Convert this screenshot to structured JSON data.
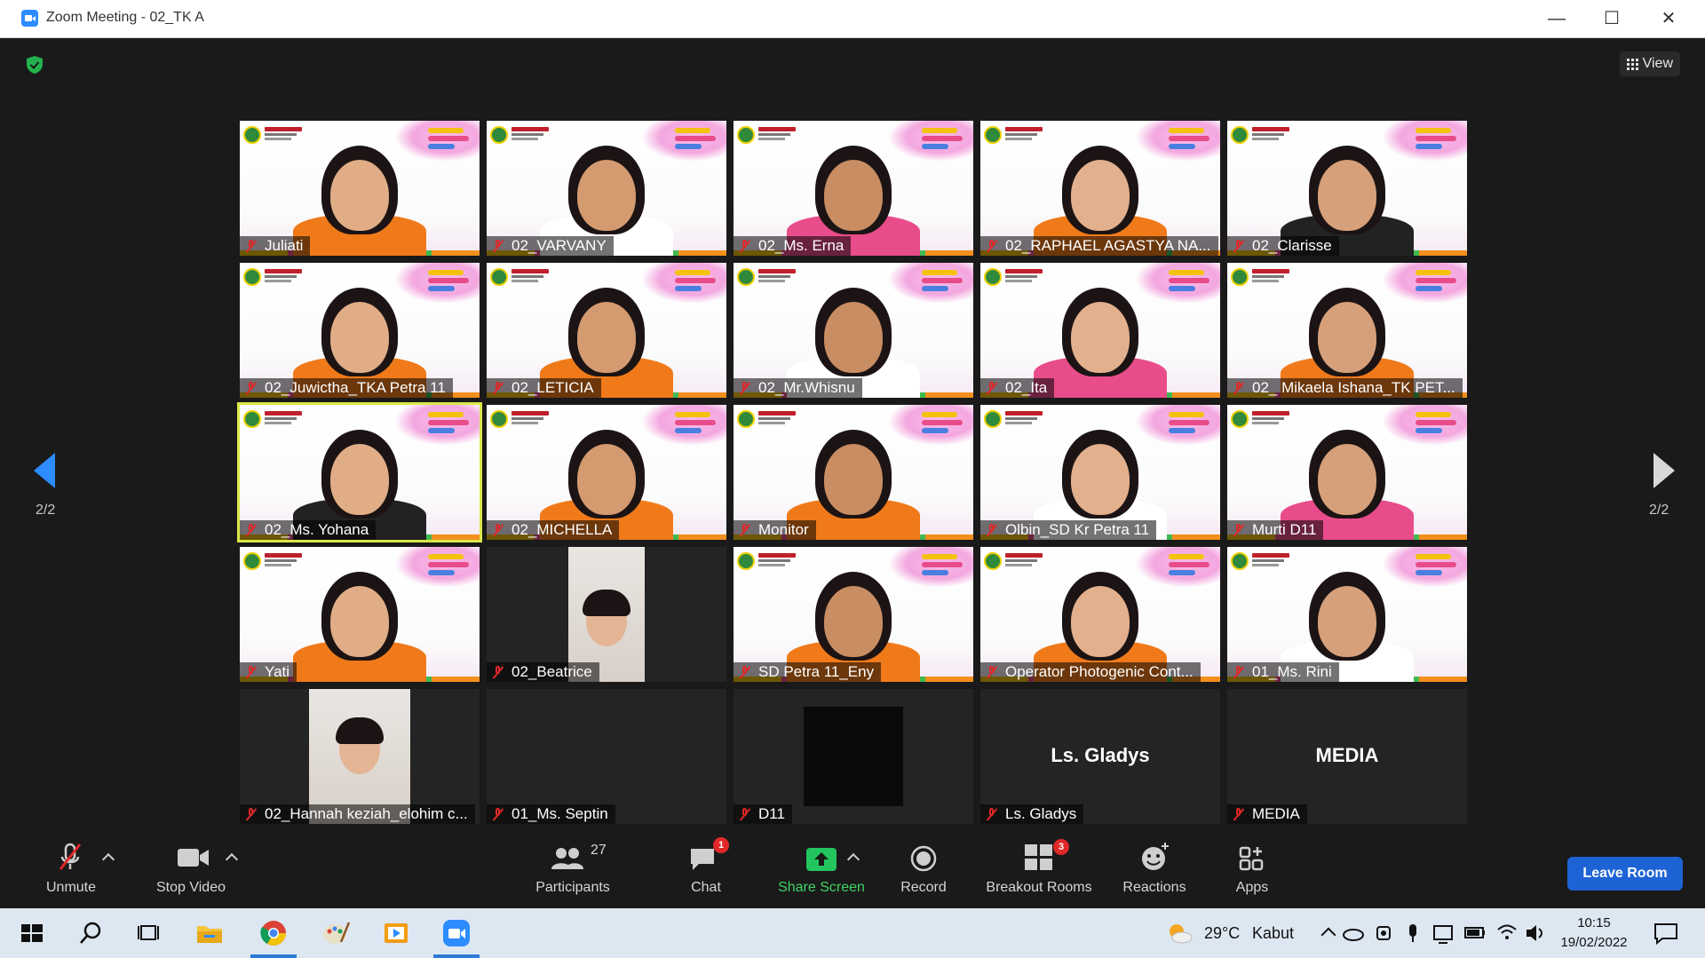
{
  "window": {
    "title": "Zoom Meeting - 02_TK A",
    "minimize": "—",
    "maximize": "☐",
    "close": "✕"
  },
  "top": {
    "view_label": "View",
    "page_left": "2/2",
    "page_right": "2/2"
  },
  "tiles": [
    {
      "name": "Juliati",
      "kind": "video"
    },
    {
      "name": "02_VARVANY",
      "kind": "video"
    },
    {
      "name": "02_Ms. Erna",
      "kind": "video"
    },
    {
      "name": "02_RAPHAEL AGASTYA NA...",
      "kind": "video"
    },
    {
      "name": "02_Clarisse",
      "kind": "video"
    },
    {
      "name": "02_Juwictha_TKA Petra 11",
      "kind": "video"
    },
    {
      "name": "02_LETICIA",
      "kind": "video"
    },
    {
      "name": "02_Mr.Whisnu",
      "kind": "video"
    },
    {
      "name": "02_Ita",
      "kind": "video"
    },
    {
      "name": "02_ Mikaela Ishana_TK PET...",
      "kind": "video"
    },
    {
      "name": "02_Ms. Yohana",
      "kind": "video",
      "active": true
    },
    {
      "name": "02_MICHELLA",
      "kind": "video"
    },
    {
      "name": "Monitor",
      "kind": "video"
    },
    {
      "name": "Olbin_SD Kr Petra 11",
      "kind": "video"
    },
    {
      "name": "Murti D11",
      "kind": "video"
    },
    {
      "name": "Yati",
      "kind": "video"
    },
    {
      "name": "02_Beatrice",
      "kind": "portrait"
    },
    {
      "name": "SD Petra 11_Eny",
      "kind": "video"
    },
    {
      "name": "Operator Photogenic Cont...",
      "kind": "video"
    },
    {
      "name": "01_Ms. Rini",
      "kind": "video"
    },
    {
      "name": "02_Hannah keziah_elohim c...",
      "kind": "portrait"
    },
    {
      "name": "01_Ms. Septin",
      "kind": "blank"
    },
    {
      "name": "D11",
      "kind": "black"
    },
    {
      "name": "Ls. Gladys",
      "kind": "name",
      "display": "Ls. Gladys"
    },
    {
      "name": "MEDIA",
      "kind": "name",
      "display": "MEDIA"
    }
  ],
  "toolbar": {
    "unmute": "Unmute",
    "stop_video": "Stop Video",
    "participants": "Participants",
    "participants_count": "27",
    "chat": "Chat",
    "chat_badge": "1",
    "share_screen": "Share Screen",
    "record": "Record",
    "breakout_rooms": "Breakout Rooms",
    "breakout_badge": "3",
    "reactions": "Reactions",
    "apps": "Apps",
    "leave": "Leave Room"
  },
  "taskbar": {
    "weather": "29°C",
    "weather_desc": "Kabut",
    "time": "10:15",
    "date": "19/02/2022"
  },
  "colors": {
    "accent": "#2d8cff",
    "leave": "#1e63d6",
    "share": "#22c55e",
    "badge": "#e02828",
    "active_outline": "#d9e84a"
  }
}
